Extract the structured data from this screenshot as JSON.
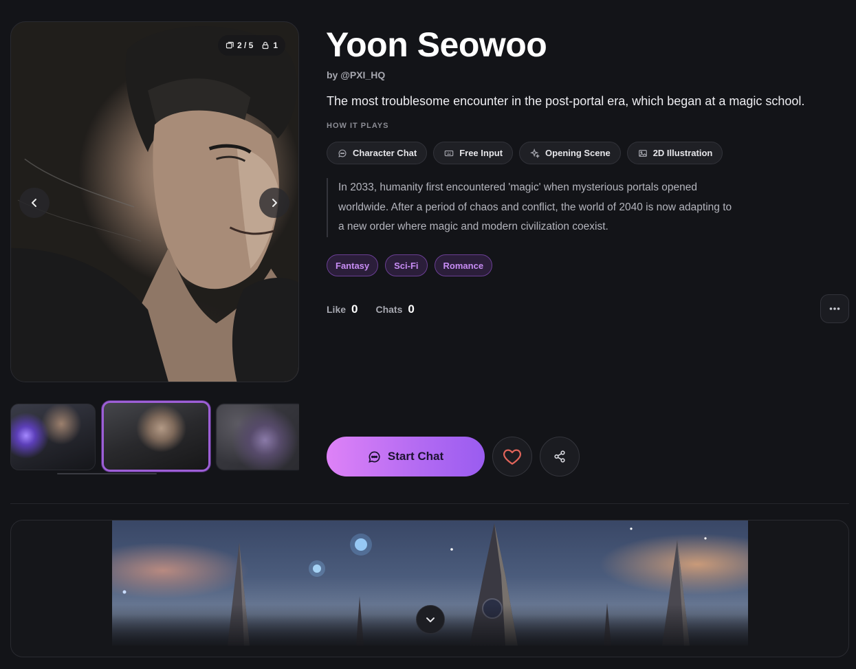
{
  "character": {
    "name": "Yoon Seowoo",
    "author": "by @PXI_HQ",
    "tagline": "The most troublesome encounter in the post-portal era, which began at a magic school."
  },
  "gallery": {
    "image_counter": "2 / 5",
    "lock_count": "1",
    "current_index": 2,
    "total": 5
  },
  "how_it_plays": {
    "label": "HOW IT PLAYS",
    "chips": [
      {
        "label": "Character Chat",
        "icon": "chat-bubble-icon"
      },
      {
        "label": "Free Input",
        "icon": "keyboard-icon"
      },
      {
        "label": "Opening Scene",
        "icon": "sparkle-icon"
      },
      {
        "label": "2D Illustration",
        "icon": "image-icon"
      }
    ]
  },
  "description": "In 2033, humanity first encountered 'magic' when mysterious portals opened worldwide. After a period of chaos and conflict, the world of 2040 is now adapting to a new order where magic and modern civilization coexist.",
  "genres": [
    "Fantasy",
    "Sci-Fi",
    "Romance"
  ],
  "stats": {
    "like_label": "Like",
    "like_count": "0",
    "chats_label": "Chats",
    "chats_count": "0"
  },
  "actions": {
    "start_chat": "Start Chat"
  },
  "colors": {
    "accent_start": "#de82f7",
    "accent_end": "#9a5cf0",
    "genre_text": "#c88df5",
    "heart": "#e0645a",
    "background": "#131418"
  }
}
